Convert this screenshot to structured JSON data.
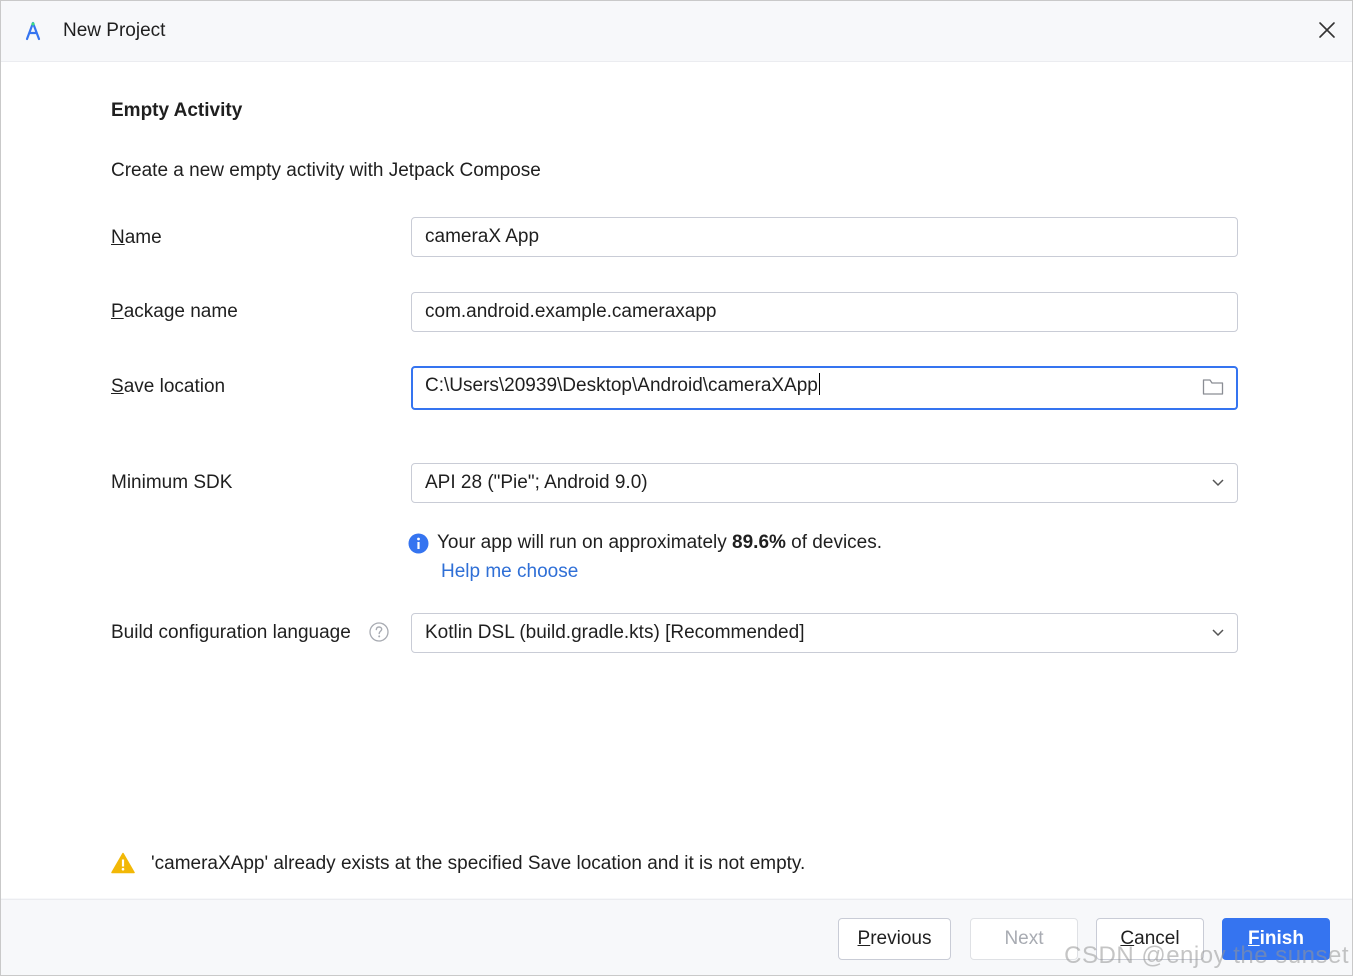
{
  "window": {
    "title": "New Project"
  },
  "page": {
    "heading": "Empty Activity",
    "description": "Create a new empty activity with Jetpack Compose"
  },
  "form": {
    "name": {
      "label_mnemonic": "N",
      "label_rest": "ame",
      "value": "cameraX App"
    },
    "package": {
      "label_mnemonic": "P",
      "label_rest": "ackage name",
      "value": "com.android.example.cameraxapp"
    },
    "save_location": {
      "label_mnemonic": "S",
      "label_rest": "ave location",
      "value": "C:\\Users\\20939\\Desktop\\Android\\cameraXApp"
    },
    "min_sdk": {
      "label": "Minimum SDK",
      "value": "API 28 (\"Pie\"; Android 9.0)",
      "info_prefix": "Your app will run on approximately ",
      "info_percent": "89.6%",
      "info_suffix": " of devices.",
      "help_link": "Help me choose"
    },
    "build_language": {
      "label": "Build configuration language",
      "value": "Kotlin DSL (build.gradle.kts) [Recommended]"
    }
  },
  "warning": {
    "text": "'cameraXApp' already exists at the specified Save location and it is not empty."
  },
  "buttons": {
    "previous_mnemonic": "P",
    "previous_rest": "revious",
    "next": "Next",
    "cancel_mnemonic": "C",
    "cancel_rest": "ancel",
    "finish_mnemonic": "F",
    "finish_rest": "inish"
  },
  "watermark": "CSDN @enjoy the sunset",
  "colors": {
    "accent": "#3574f0",
    "link": "#2f6fd6",
    "warning": "#f2b807",
    "info": "#3574f0"
  },
  "icons": [
    "android-studio-icon",
    "close-icon",
    "folder-icon",
    "chevron-down-icon",
    "info-icon",
    "question-icon",
    "warning-icon"
  ]
}
